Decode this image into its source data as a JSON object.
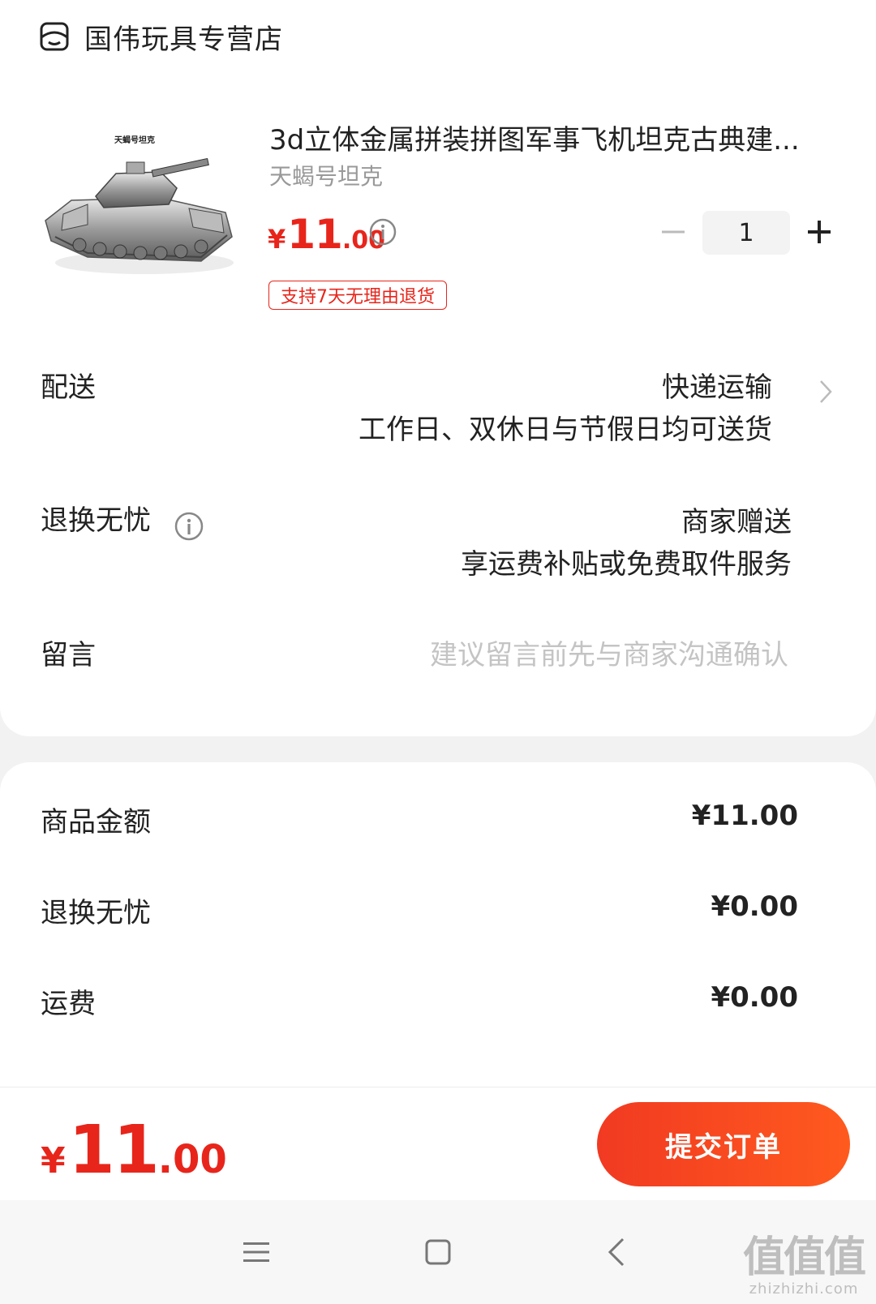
{
  "store": {
    "name": "国伟玩具专营店",
    "icon": "store-face-icon"
  },
  "product": {
    "image_caption": "天蝎号坦克",
    "title": "3d立体金属拼装拼图军事飞机坦克古典建...",
    "variant": "天蝎号坦克",
    "price_symbol": "¥",
    "price_int": "11",
    "price_dec": ".00",
    "quantity": "1",
    "return_badge": "支持7天无理由退货"
  },
  "delivery": {
    "label": "配送",
    "method": "快递运输",
    "note": "工作日、双休日与节假日均可送货"
  },
  "returns": {
    "label": "退换无忧",
    "value": "商家赠送",
    "note": "享运费补贴或免费取件服务"
  },
  "message": {
    "label": "留言",
    "placeholder": "建议留言前先与商家沟通确认"
  },
  "summary": [
    {
      "label": "商品金额",
      "value": "¥11.00"
    },
    {
      "label": "退换无忧",
      "value": "¥0.00"
    },
    {
      "label": "运费",
      "value": "¥0.00"
    }
  ],
  "footer": {
    "total_symbol": "¥",
    "total_int": "11",
    "total_dec": ".00",
    "submit_label": "提交订单"
  },
  "watermark": {
    "big": "值值值",
    "small": "zhizhizhi.com"
  },
  "colors": {
    "accent": "#e8251b",
    "button_start": "#f13a22",
    "button_end": "#ff5a1e",
    "muted": "#999999"
  }
}
